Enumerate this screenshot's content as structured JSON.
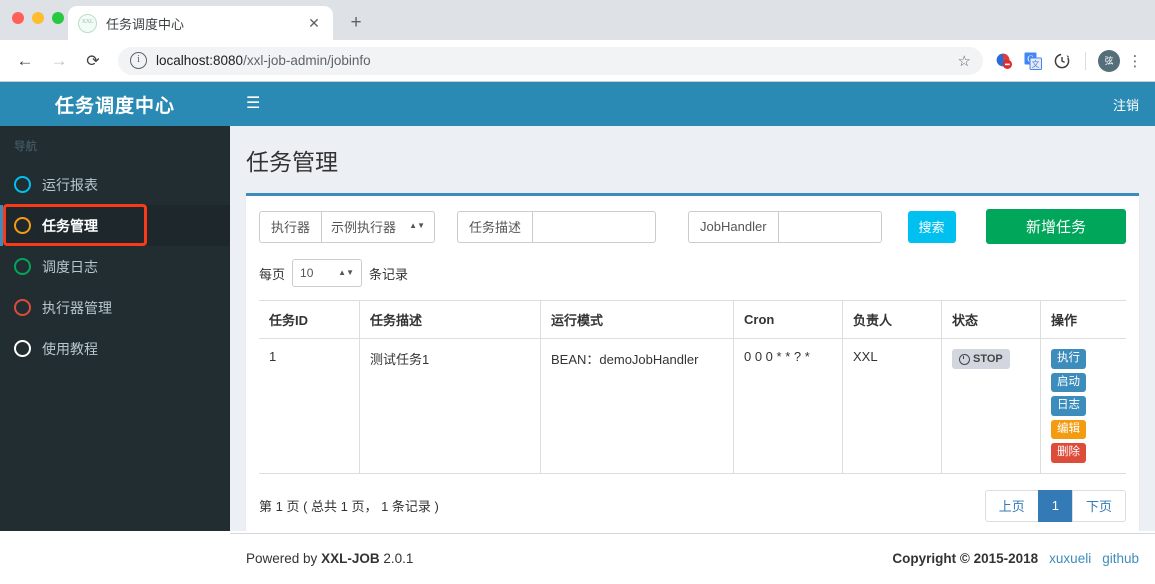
{
  "browser": {
    "tab_title": "任务调度中心",
    "favicon_text": "XXL",
    "new_tab_label": "+",
    "close_label": "✕",
    "back_label": "←",
    "forward_label": "→",
    "reload_label": "⟳",
    "url_host": "localhost:8080",
    "url_path": "/xxl-job-admin/jobinfo",
    "star_label": "☆",
    "profile_initial": "弦",
    "menu_label": "⋮"
  },
  "sidebar": {
    "brand": "任务调度中心",
    "section_label": "导航",
    "items": [
      {
        "label": "运行报表",
        "icon": "circle-icon",
        "color": "#00c0ef",
        "active": false
      },
      {
        "label": "任务管理",
        "icon": "circle-icon",
        "color": "#f39c12",
        "active": true
      },
      {
        "label": "调度日志",
        "icon": "circle-icon",
        "color": "#00a65a",
        "active": false
      },
      {
        "label": "执行器管理",
        "icon": "circle-icon",
        "color": "#dd4b39",
        "active": false
      },
      {
        "label": "使用教程",
        "icon": "circle-icon",
        "color": "#ffffff",
        "active": false
      }
    ]
  },
  "topbar": {
    "menu_toggle": "☰",
    "logout_label": "注销"
  },
  "page": {
    "title": "任务管理"
  },
  "filters": {
    "executor_label": "执行器",
    "executor_value": "示例执行器",
    "job_desc_label": "任务描述",
    "job_desc_value": "",
    "job_handler_label": "JobHandler",
    "job_handler_value": "",
    "search_button": "搜索",
    "add_button": "新增任务"
  },
  "pagesize": {
    "prefix": "每页",
    "value": "10",
    "suffix": "条记录"
  },
  "table": {
    "headers": [
      "任务ID",
      "任务描述",
      "运行模式",
      "Cron",
      "负责人",
      "状态",
      "操作"
    ],
    "rows": [
      {
        "id": "1",
        "desc": "测试任务1",
        "mode": "BEAN：demoJobHandler",
        "cron": "0 0 0 * * ? *",
        "owner": "XXL",
        "status": "STOP",
        "status_icon": "ban-icon",
        "ops": [
          {
            "label": "执行",
            "color": "blue"
          },
          {
            "label": "启动",
            "color": "blue"
          },
          {
            "label": "日志",
            "color": "blue"
          },
          {
            "label": "编辑",
            "color": "orange"
          },
          {
            "label": "删除",
            "color": "red"
          }
        ]
      }
    ]
  },
  "pagination": {
    "info": "第 1 页 ( 总共 1 页， 1 条记录 )",
    "prev": "上页",
    "current": "1",
    "next": "下页"
  },
  "footer": {
    "powered_prefix": "Powered by",
    "powered_brand": "XXL-JOB",
    "powered_version": "2.0.1",
    "copyright": "Copyright © 2015-2018",
    "link_author": "xuxueli",
    "link_github": "github"
  },
  "colors": {
    "brand_blue": "#2a8ab3",
    "sidebar_dark": "#222d32",
    "accent_info": "#00c0ef",
    "accent_success": "#00a65a",
    "accent_primary": "#3c8dbc",
    "accent_warning": "#f39c12",
    "accent_danger": "#dd4b39",
    "highlight_box": "#f93a19",
    "content_bg": "#ecf0f5"
  }
}
